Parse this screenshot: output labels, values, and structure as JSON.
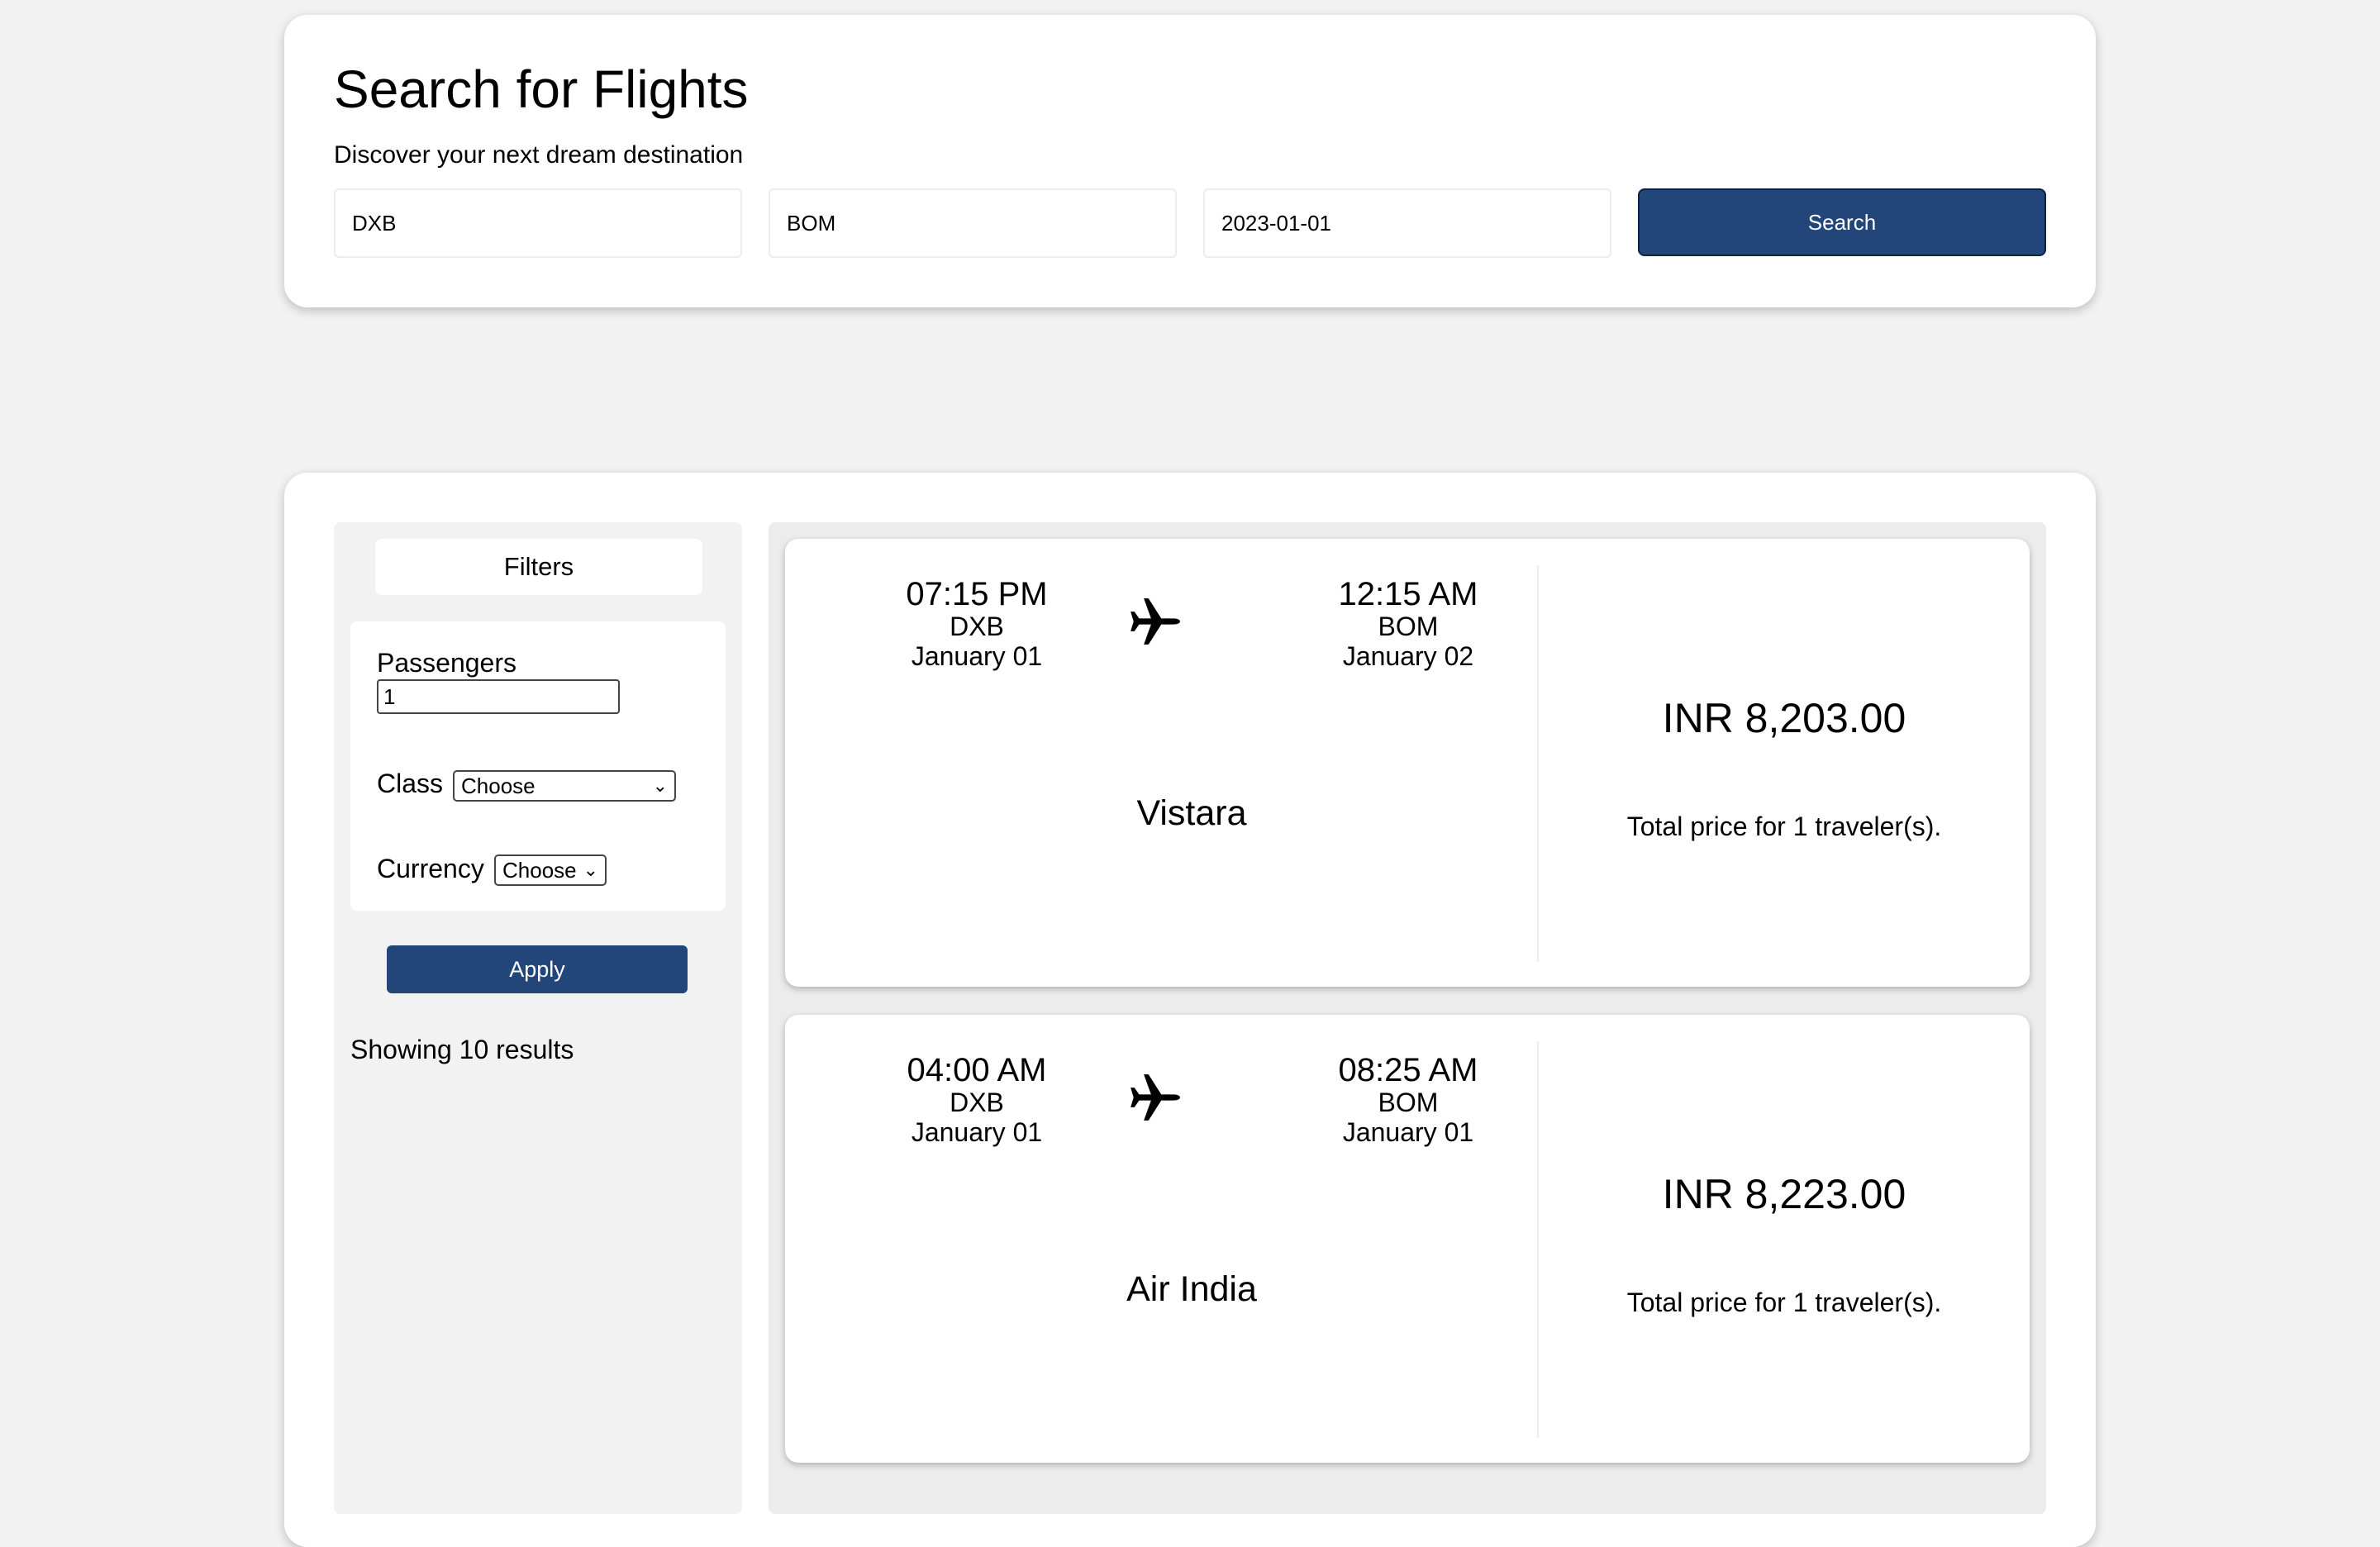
{
  "search": {
    "title": "Search for Flights",
    "subtitle": "Discover your next dream destination",
    "from_value": "DXB",
    "to_value": "BOM",
    "date_value": "2023-01-01",
    "button_label": "Search"
  },
  "filters": {
    "header": "Filters",
    "passengers_label": "Passengers",
    "passengers_value": "1",
    "class_label": "Class",
    "class_selected": "Choose",
    "currency_label": "Currency",
    "currency_selected": "Choose",
    "apply_label": "Apply",
    "results_count": "Showing 10 results"
  },
  "flights": [
    {
      "departure": {
        "time": "07:15 PM",
        "code": "DXB",
        "date": "January 01"
      },
      "arrival": {
        "time": "12:15 AM",
        "code": "BOM",
        "date": "January 02"
      },
      "airline": "Vistara",
      "price": "INR 8,203.00",
      "price_note": "Total price for 1 traveler(s)."
    },
    {
      "departure": {
        "time": "04:00 AM",
        "code": "DXB",
        "date": "January 01"
      },
      "arrival": {
        "time": "08:25 AM",
        "code": "BOM",
        "date": "January 01"
      },
      "airline": "Air India",
      "price": "INR 8,223.00",
      "price_note": "Total price for 1 traveler(s)."
    }
  ],
  "icons": {
    "plane": "airplane-icon",
    "dropdown": "chevron-down-icon"
  },
  "colors": {
    "primary": "#22457a",
    "background": "#f2f2f2",
    "card": "#ffffff"
  }
}
